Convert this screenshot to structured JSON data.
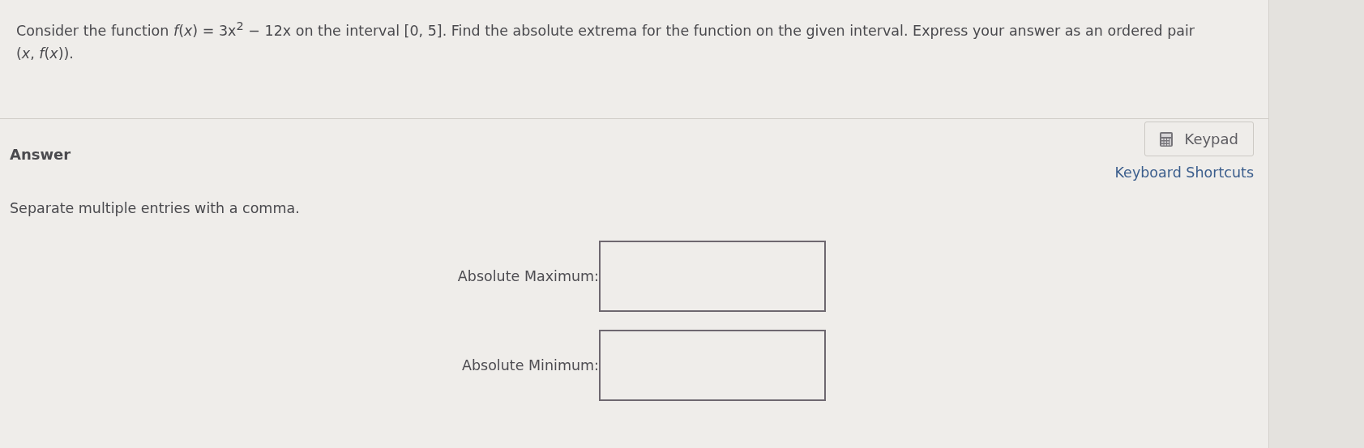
{
  "question": "Consider the function *f*(*x*) = 3x$^{2}$ − 12x on the interval [0, 5]. Find the absolute extrema for the function on the given interval. Express your answer as an ordered pair (*x*, *f*(*x*)).",
  "answer_heading": "Answer",
  "keypad_button": "Keypad",
  "keyboard_shortcuts_link": "Keyboard Shortcuts",
  "instruction": "Separate multiple entries with a comma.",
  "fields": [
    {
      "label": "Absolute Maximum:"
    },
    {
      "label": "Absolute Minimum:"
    }
  ]
}
